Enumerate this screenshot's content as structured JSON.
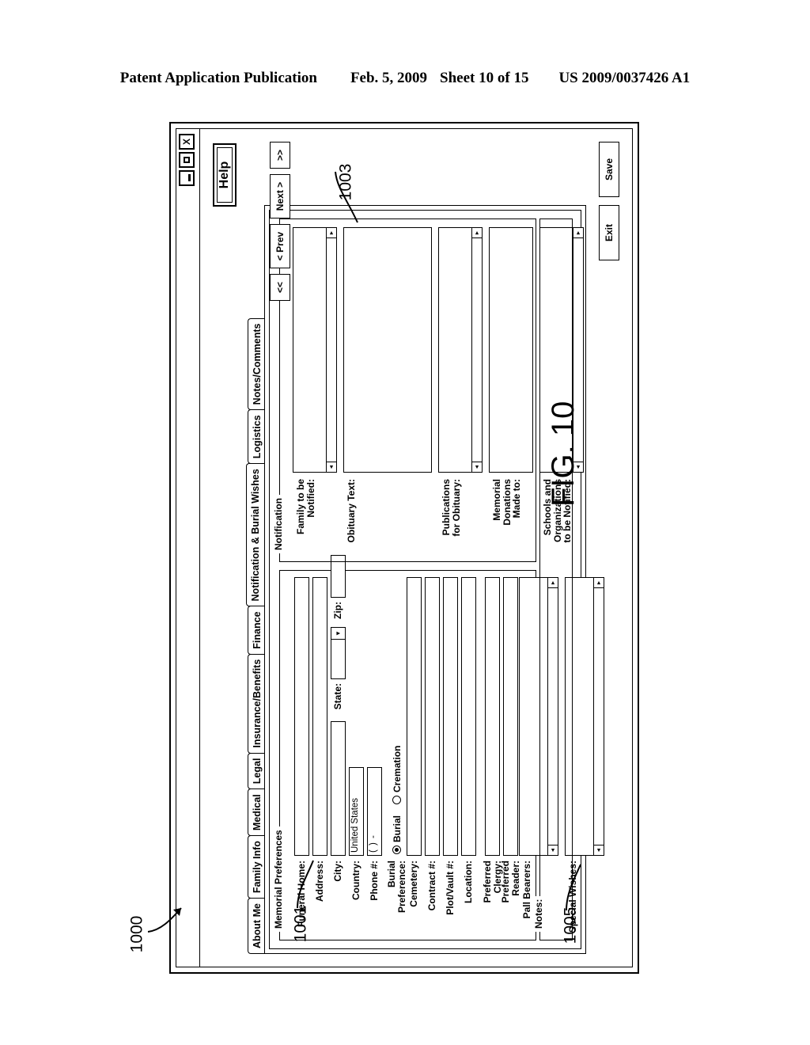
{
  "patent_header": {
    "publication": "Patent Application Publication",
    "date": "Feb. 5, 2009",
    "sheet": "Sheet 10 of 15",
    "number": "US 2009/0037426 A1"
  },
  "figure": {
    "caption": "FIG. 10",
    "numerals": {
      "window": "1000",
      "left_panel": "1001",
      "right_panel": "1003",
      "notes_panel": "1005"
    }
  },
  "window": {
    "controls": {
      "minimize": "minimize-icon",
      "maximize": "maximize-icon",
      "close": "X"
    },
    "help_label": "Help"
  },
  "tabs": [
    {
      "label": "About Me",
      "selected": false
    },
    {
      "label": "Family Info",
      "selected": false
    },
    {
      "label": "Medical",
      "selected": false
    },
    {
      "label": "Legal",
      "selected": false
    },
    {
      "label": "Insurance/Benefits",
      "selected": false
    },
    {
      "label": "Finance",
      "selected": false
    },
    {
      "label": "Notification & Burial Wishes",
      "selected": true
    },
    {
      "label": "Logistics",
      "selected": false
    },
    {
      "label": "Notes/Comments",
      "selected": false
    }
  ],
  "memorial_preferences": {
    "group_label": "Memorial Preferences",
    "fields": {
      "funeral_home": {
        "label": "Funeral Home:",
        "value": ""
      },
      "address": {
        "label": "Address:",
        "value": ""
      },
      "city": {
        "label": "City:",
        "value": ""
      },
      "state": {
        "label": "State:",
        "value": ""
      },
      "zip": {
        "label": "Zip:",
        "value": ""
      },
      "country": {
        "label": "Country:",
        "value": "United States"
      },
      "phone": {
        "label": "Phone #:",
        "value": "(    )     -"
      },
      "burial_preference": {
        "label": "Burial Preference:",
        "options": [
          {
            "label": "Burial",
            "selected": true
          },
          {
            "label": "Cremation",
            "selected": false
          }
        ]
      },
      "cemetery": {
        "label": "Cemetery:",
        "value": ""
      },
      "contract_no": {
        "label": "Contract #:",
        "value": ""
      },
      "plot_vault_no": {
        "label": "Plot/Vault #:",
        "value": ""
      },
      "location": {
        "label": "Location:",
        "value": ""
      },
      "preferred_clergy": {
        "label": "Preferred Clergy:",
        "value": ""
      },
      "preferred_reader": {
        "label": "Preferred Reader:",
        "value": ""
      },
      "pall_bearers": {
        "label": "Pall Bearers:",
        "value": ""
      },
      "special_wishes": {
        "label": "Special Wishes:",
        "value": ""
      }
    }
  },
  "notification": {
    "group_label": "Notification",
    "fields": {
      "family_to_be_notified": {
        "label": "Family to be\nNotified:",
        "value": ""
      },
      "obituary_text": {
        "label": "Obituary Text:",
        "value": ""
      },
      "publications_for_obituary": {
        "label": "Publications\nfor Obituary:",
        "value": ""
      },
      "memorial_donations": {
        "label": "Memorial\nDonations\nMade to:",
        "value": ""
      },
      "schools_and_orgs": {
        "label": "Schools and\nOrganizations\nto be Notified:",
        "value": ""
      }
    }
  },
  "notes": {
    "label": "Notes:",
    "value": ""
  },
  "navigation": {
    "first": "<<",
    "prev": "< Prev",
    "next": "Next >",
    "last": ">>"
  },
  "actions": {
    "exit": "Exit",
    "save": "Save"
  },
  "scroll_icons": {
    "left": "◄",
    "right": "►",
    "down": "▼"
  }
}
